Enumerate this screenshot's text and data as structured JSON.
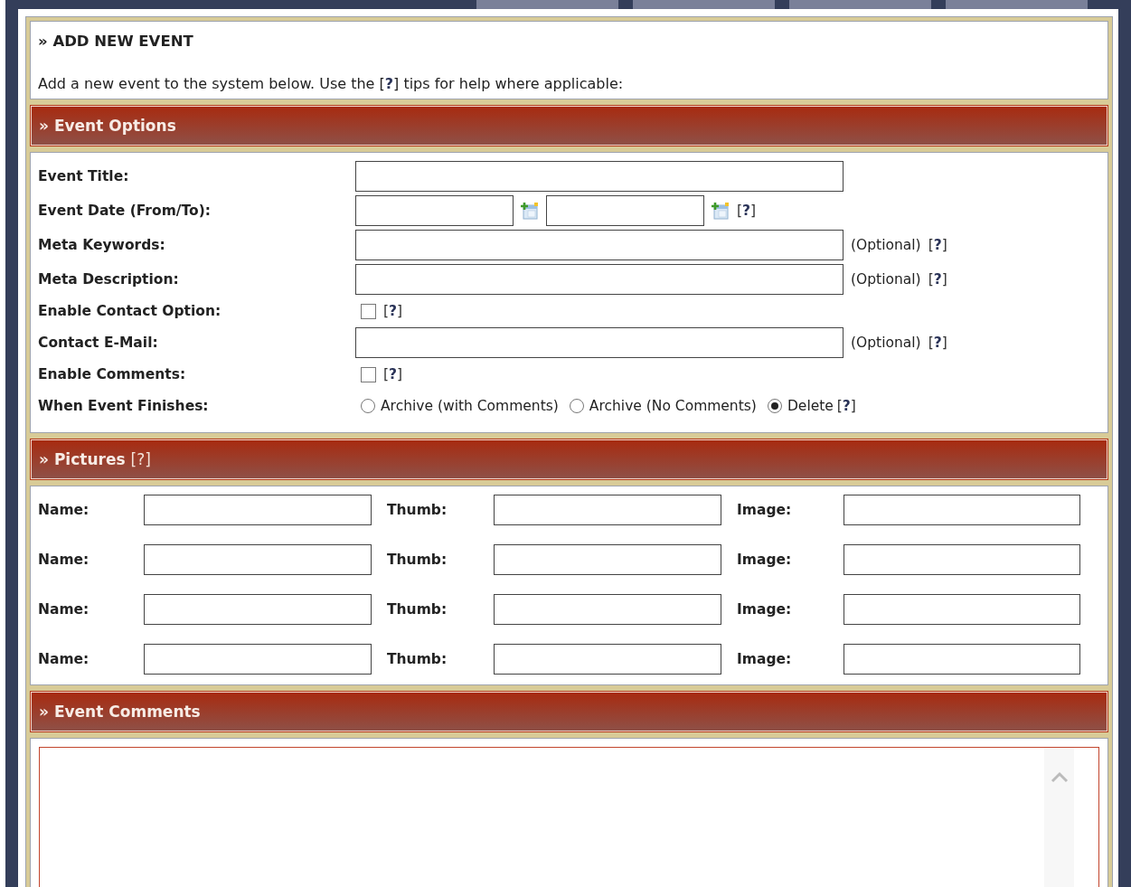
{
  "nav_tabs": [
    {
      "selected": false
    },
    {
      "selected": false
    },
    {
      "selected": false
    },
    {
      "selected": false
    }
  ],
  "intro": {
    "title": "» ADD NEW EVENT",
    "text": "Add a new event to the system below. Use the [**?**] tips for help where applicable:"
  },
  "event_options": {
    "title": "» Event Options",
    "rows": [
      {
        "kind": "text",
        "label": "Event Title:"
      },
      {
        "kind": "date",
        "label": "Event Date (From/To):",
        "help": "[**?**]"
      },
      {
        "kind": "text",
        "label": "Meta Keywords:",
        "note": "(Optional)",
        "help": "[**?**]"
      },
      {
        "kind": "text",
        "label": "Meta Description:",
        "note": "(Optional)",
        "help": "[**?**]"
      },
      {
        "kind": "checkbox",
        "label": "Enable Contact Option:",
        "checked": false,
        "help": "[**?**]"
      },
      {
        "kind": "text",
        "label": "Contact E-Mail:",
        "note": "(Optional)",
        "help": "[**?**]"
      },
      {
        "kind": "checkbox",
        "label": "Enable Comments:",
        "checked": false,
        "help": "[**?**]"
      },
      {
        "kind": "radio",
        "label": "When Event Finishes:",
        "help": "[**?**]",
        "options": [
          {
            "label": "Archive (with Comments)",
            "selected": false
          },
          {
            "label": "Archive (No Comments)",
            "selected": false
          },
          {
            "label": "Delete",
            "selected": true
          }
        ]
      }
    ]
  },
  "pictures": {
    "title": "» Pictures",
    "help": "[?]",
    "rows": [
      {
        "fields": [
          {
            "label": "Name:"
          },
          {
            "label": "Thumb:"
          },
          {
            "label": "Image:"
          }
        ]
      },
      {
        "fields": [
          {
            "label": "Name:"
          },
          {
            "label": "Thumb:"
          },
          {
            "label": "Image:"
          }
        ]
      },
      {
        "fields": [
          {
            "label": "Name:"
          },
          {
            "label": "Thumb:"
          },
          {
            "label": "Image:"
          }
        ]
      },
      {
        "fields": [
          {
            "label": "Name:"
          },
          {
            "label": "Thumb:"
          },
          {
            "label": "Image:"
          }
        ]
      }
    ]
  },
  "event_comments": {
    "title": "» Event Comments"
  }
}
